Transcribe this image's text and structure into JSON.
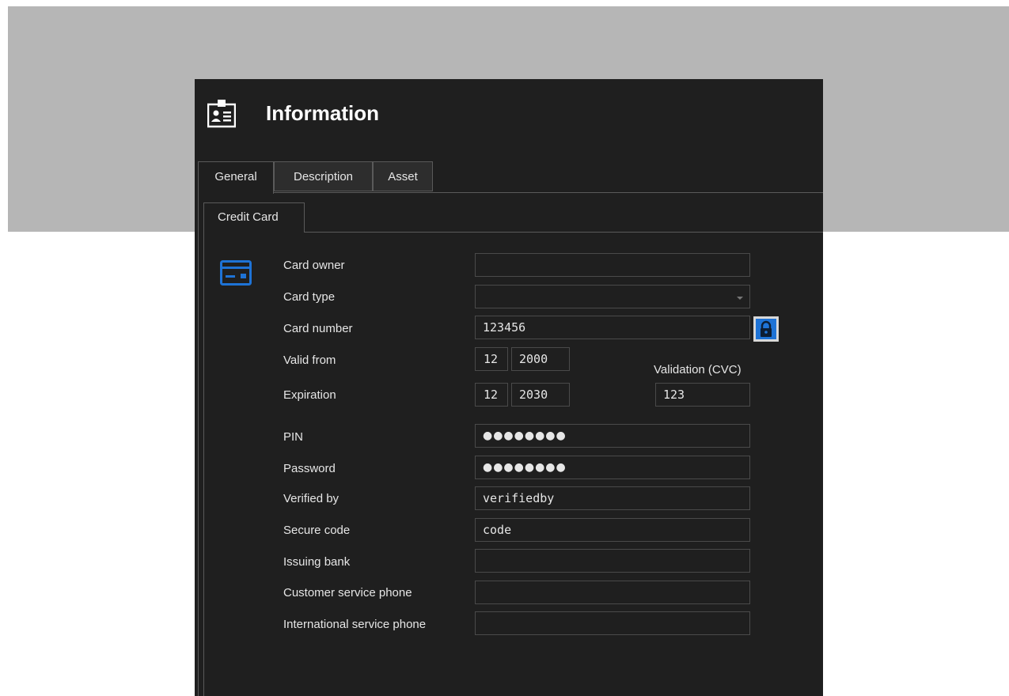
{
  "header": {
    "title": "Information",
    "icon": "contact-card-icon"
  },
  "tabs": [
    {
      "label": "General",
      "active": true
    },
    {
      "label": "Description",
      "active": false
    },
    {
      "label": "Asset",
      "active": false
    }
  ],
  "subtabs": [
    {
      "label": "Credit Card",
      "active": true
    }
  ],
  "form": {
    "card_icon": "credit-card-icon",
    "accent_color": "#1e73d6",
    "card_owner": {
      "label": "Card owner",
      "value": ""
    },
    "card_type": {
      "label": "Card type",
      "value": ""
    },
    "card_number": {
      "label": "Card number",
      "value": "123456"
    },
    "valid_from": {
      "label": "Valid from",
      "month": "12",
      "year": "2000"
    },
    "expiration": {
      "label": "Expiration",
      "month": "12",
      "year": "2030"
    },
    "cvc": {
      "label": "Validation (CVC)",
      "value": "123"
    },
    "pin": {
      "label": "PIN",
      "value": "●●●●●●●●"
    },
    "password": {
      "label": "Password",
      "value": "●●●●●●●●"
    },
    "verified_by": {
      "label": "Verified by",
      "value": "verifiedby"
    },
    "secure_code": {
      "label": "Secure code",
      "value": "code"
    },
    "issuing_bank": {
      "label": "Issuing bank",
      "value": ""
    },
    "customer_service_phone": {
      "label": "Customer service phone",
      "value": ""
    },
    "international_service_phone": {
      "label": "International service phone",
      "value": ""
    }
  }
}
